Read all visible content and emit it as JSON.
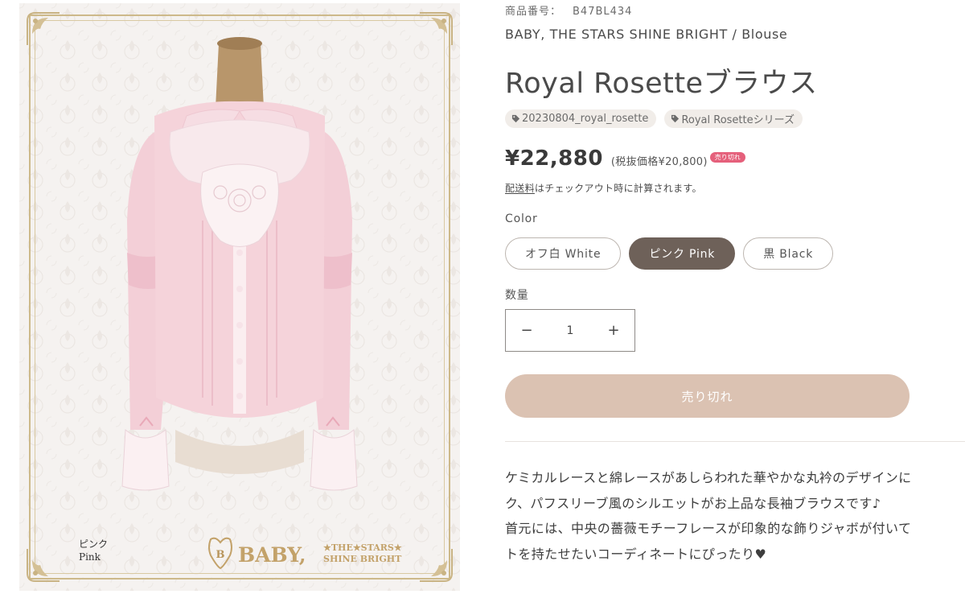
{
  "product_image": {
    "alt": "Royal Rosetteブラウス ピンク Pink",
    "color_caption_ja": "ピンク",
    "color_caption_en": "Pink",
    "logo_text_main": "BABY,",
    "logo_text_sub_1": "THE STARS",
    "logo_text_sub_2": "SHINE BRIGHT"
  },
  "product": {
    "sku_label": "商品番号：",
    "sku_value": "B47BL434",
    "brand_line": "BABY, THE STARS SHINE BRIGHT / Blouse",
    "title": "Royal Rosetteブラウス",
    "tags": [
      {
        "label": "20230804_royal_rosette"
      },
      {
        "label": "Royal Rosetteシリーズ"
      }
    ],
    "price": "¥22,880",
    "price_note": "(税抜価格¥20,800)",
    "soldout_badge": "売り切れ",
    "shipping_link": "配送料",
    "shipping_rest": "はチェックアウト時に計算されます。"
  },
  "options": {
    "color_label": "Color",
    "colors": [
      {
        "label": "オフ白 White",
        "selected": false
      },
      {
        "label": "ピンク Pink",
        "selected": true
      },
      {
        "label": "黒 Black",
        "selected": false
      }
    ],
    "selected_color": "ピンク Pink"
  },
  "quantity": {
    "label": "数量",
    "value": "1",
    "minus": "−",
    "plus": "+"
  },
  "cta": {
    "soldout_label": "売り切れ"
  },
  "description": {
    "lines": [
      "ケミカルレースと綿レースがあしらわれた華やかな丸衿のデザインに",
      "ク、パフスリーブ風のシルエットがお上品な長袖ブラウスです♪",
      "首元には、中央の薔薇モチーフレースが印象的な飾りジャボが付いて",
      "トを持たせたいコーディネートにぴったり♥"
    ]
  },
  "colors": {
    "accent_button": "#dbc2b2",
    "selected_swatch": "#6e6159",
    "badge": "#e5607b",
    "tag_bg": "#f1ede9",
    "frame_gold": "#cdb98a",
    "blouse_pink": "#f3cfd7"
  }
}
